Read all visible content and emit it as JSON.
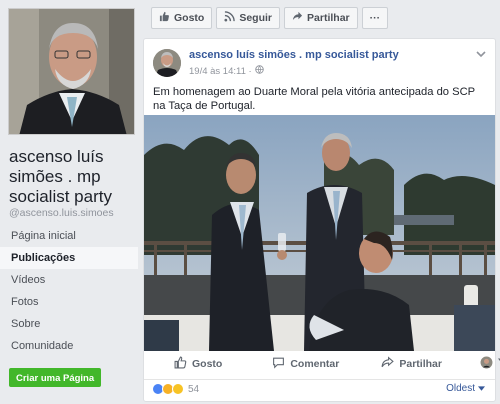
{
  "page": {
    "name": "ascenso luís simões . mp socialist party",
    "handle": "@ascenso.luis.simoes"
  },
  "nav": {
    "items": [
      {
        "label": "Página inicial"
      },
      {
        "label": "Publicações"
      },
      {
        "label": "Vídeos"
      },
      {
        "label": "Fotos"
      },
      {
        "label": "Sobre"
      },
      {
        "label": "Comunidade"
      }
    ],
    "active_index": 1
  },
  "create_page_label": "Criar uma Página",
  "action_bar": {
    "like_label": "Gosto",
    "follow_label": "Seguir",
    "share_label": "Partilhar",
    "more_label": "···"
  },
  "post": {
    "author": "ascenso luís simões . mp socialist party",
    "date": "19/4 às 14:11 ·",
    "text": "Em homenagem ao Duarte Moral pela vitória antecipada do SCP na Taça de Portugal.",
    "actions": {
      "like_label": "Gosto",
      "comment_label": "Comentar",
      "share_label": "Partilhar"
    },
    "reaction_count": "54",
    "sort_label": "Oldest"
  },
  "colors": {
    "accent_link": "#365899",
    "create_button": "#42b72a",
    "background": "#e9ebee"
  }
}
